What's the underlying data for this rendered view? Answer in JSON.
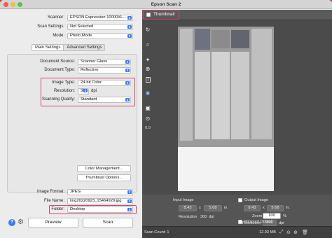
{
  "window": {
    "title": "Epson Scan 2"
  },
  "scanner": {
    "label": "Scanner:",
    "value": "EPSON Expression 10000XL..."
  },
  "scan_settings": {
    "label": "Scan Settings:",
    "value": "Not Selected"
  },
  "mode": {
    "label": "Mode:",
    "value": "Photo Mode"
  },
  "tabs": {
    "main": "Main Settings",
    "advanced": "Advanced Settings"
  },
  "main_settings": {
    "document_source": {
      "label": "Document Source:",
      "value": "Scanner Glass"
    },
    "document_type": {
      "label": "Document Type:",
      "value": "Reflective"
    },
    "image_type": {
      "label": "Image Type:",
      "value": "24-bit Color"
    },
    "resolution": {
      "label": "Resolution:",
      "value": "300",
      "unit": "dpi"
    },
    "scanning_quality": {
      "label": "Scanning Quality:",
      "value": "Standard"
    }
  },
  "buttons": {
    "color_management": "Color Management...",
    "thumbnail_options": "Thumbnail Options...",
    "preview": "Preview",
    "scan": "Scan"
  },
  "output": {
    "image_format": {
      "label": "Image Format:",
      "value": "JPEG"
    },
    "file_name": {
      "label": "File Name:",
      "value": "img20220923_15464929.jpg"
    },
    "folder": {
      "label": "Folder:",
      "value": "Desktop"
    }
  },
  "thumbnail": {
    "label": "Thumbnail",
    "checked": false
  },
  "toolbar_icons": [
    "rotate-icon",
    "zoom-icon",
    "auto-adjust-icon",
    "add-area-icon",
    "count-icon",
    "color-restore-icon",
    "settings-icon",
    "export-icon"
  ],
  "toolbar_number": "1",
  "toolbar_zoom_value": "0.0",
  "input_image": {
    "title": "Input Image",
    "width": "8.43",
    "times": "x",
    "height": "5.68",
    "unit": "in.",
    "resolution_label": "Resolution",
    "resolution_value": "300",
    "resolution_unit": "dpi"
  },
  "output_image": {
    "title": "Output Image",
    "checked": false,
    "width": "8.43",
    "times": "x",
    "height": "5.68",
    "unit": "in.",
    "zoom_label": "Zoom",
    "zoom_value": "100",
    "zoom_unit": "%",
    "resolution_label": "Resolution",
    "resolution_value": "300",
    "resolution_unit": "dpi"
  },
  "mirrored_output": {
    "label": "Mirrored Output",
    "checked": false
  },
  "status": {
    "scan_count": "Scan Count: 1",
    "size": "12.93 MB"
  },
  "colors": {
    "highlight": "#d9426a",
    "accent": "#3a7bf5",
    "titlebar_bg": "#d4d4d4",
    "preview_bg": "#4b4b4b"
  }
}
